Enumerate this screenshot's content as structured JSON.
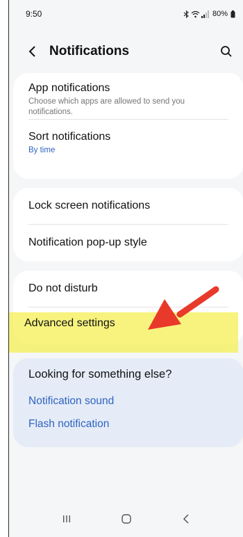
{
  "status_bar": {
    "time": "9:50",
    "battery": "80%"
  },
  "header": {
    "title": "Notifications"
  },
  "sections": {
    "app_notifications": {
      "title": "App notifications",
      "subtitle": "Choose which apps are allowed to send you notifications."
    },
    "sort_notifications": {
      "title": "Sort notifications",
      "value": "By time"
    },
    "lock_screen": {
      "title": "Lock screen notifications"
    },
    "popup_style": {
      "title": "Notification pop-up style"
    },
    "do_not_disturb": {
      "title": "Do not disturb"
    },
    "advanced_settings": {
      "title": "Advanced settings"
    }
  },
  "looking_for": {
    "heading": "Looking for something else?",
    "links": [
      "Notification sound",
      "Flash notification"
    ]
  },
  "colors": {
    "accent": "#2f63c1",
    "highlight": "#f5f05a",
    "arrow": "#e8392b"
  },
  "icons": {
    "status": [
      "bluetooth-icon",
      "wifi-icon",
      "signal-icon",
      "battery-icon"
    ],
    "nav": [
      "recent-apps-icon",
      "home-icon",
      "back-icon"
    ]
  }
}
